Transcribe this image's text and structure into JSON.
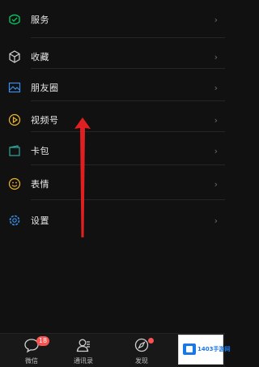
{
  "menu": {
    "items": [
      {
        "label": "服务",
        "icon": "service-icon"
      },
      {
        "label": "收藏",
        "icon": "favorites-icon"
      },
      {
        "label": "朋友圈",
        "icon": "moments-icon"
      },
      {
        "label": "视频号",
        "icon": "channels-icon"
      },
      {
        "label": "卡包",
        "icon": "card-wallet-icon"
      },
      {
        "label": "表情",
        "icon": "sticker-icon"
      },
      {
        "label": "设置",
        "icon": "settings-icon"
      }
    ],
    "chevron": "›"
  },
  "tabbar": {
    "tabs": [
      {
        "label": "微信",
        "badge": "18"
      },
      {
        "label": "通讯录"
      },
      {
        "label": "发现"
      }
    ]
  },
  "watermark": {
    "text": "1403手游网"
  },
  "colors": {
    "accent_green": "#07c160",
    "blue": "#3a8ee6",
    "yellow": "#f0b52e",
    "arrow_red": "#e02020",
    "badge_red": "#fa5151"
  }
}
